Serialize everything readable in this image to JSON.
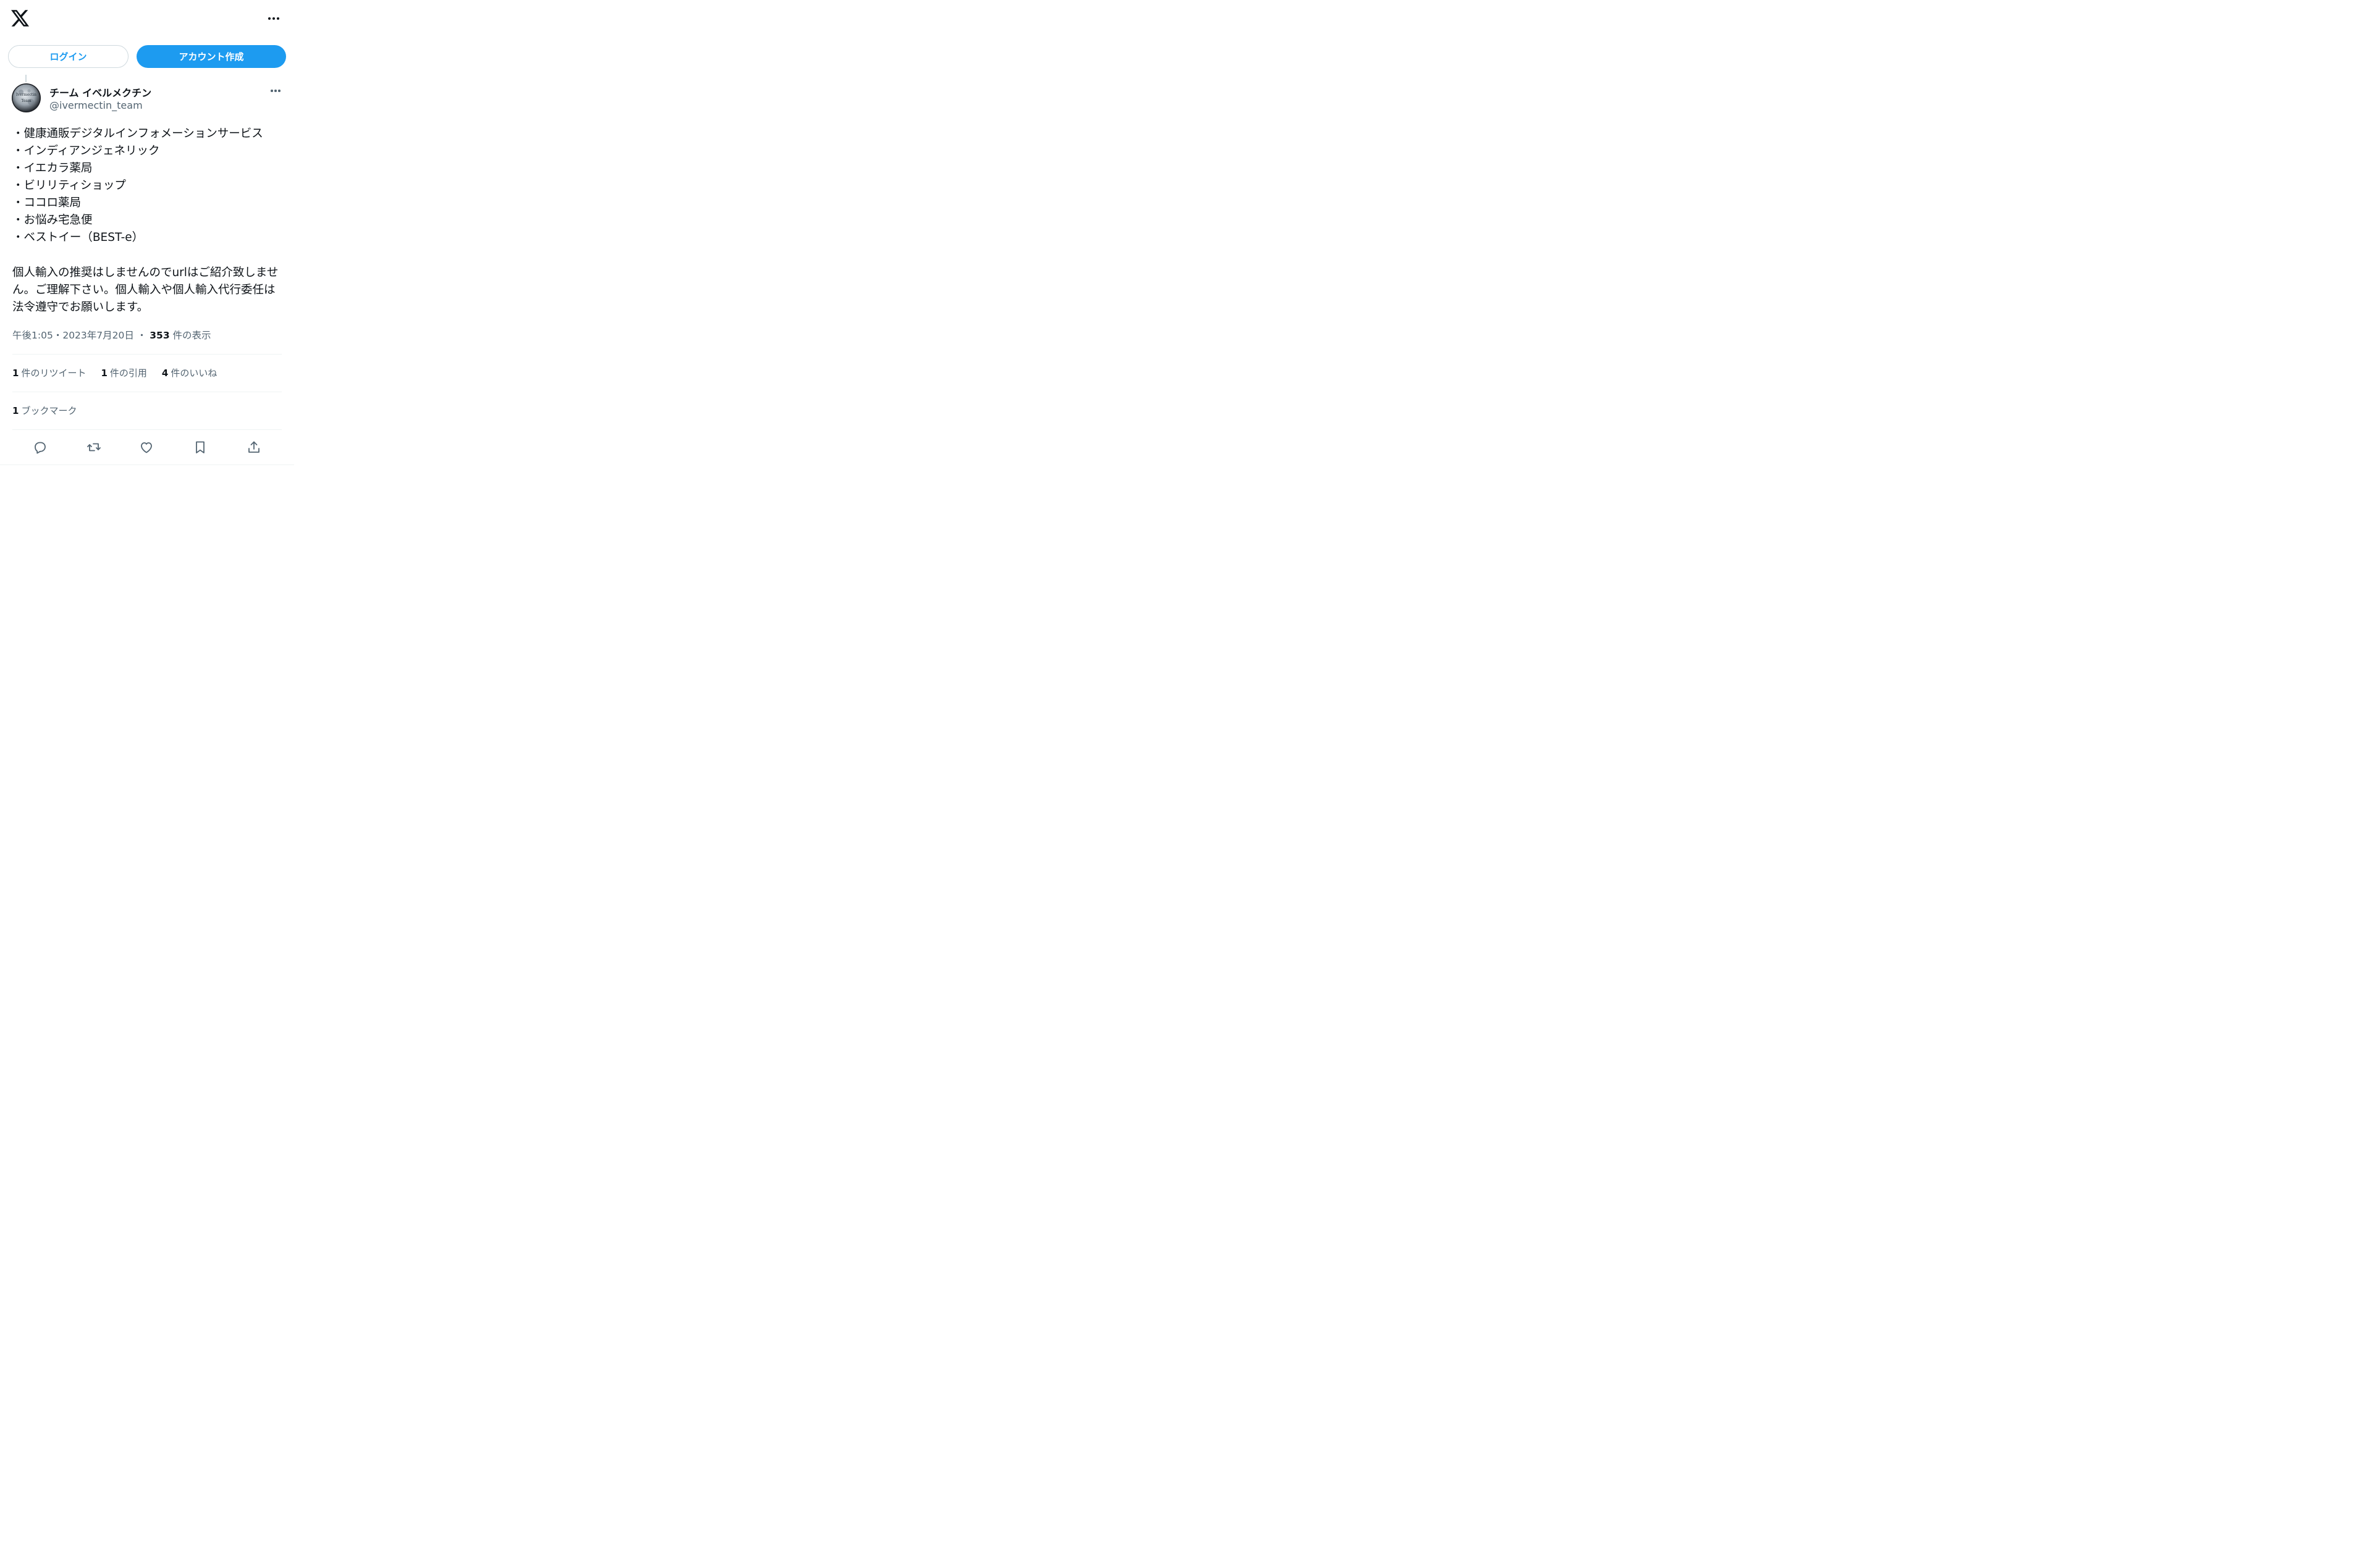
{
  "header": {
    "logo": "x-logo-icon",
    "more": "more-horizontal-icon"
  },
  "auth": {
    "login_label": "ログイン",
    "signup_label": "アカウント作成",
    "accent_color": "#1d9bf0"
  },
  "post": {
    "author_name": "チーム イベルメクチン",
    "handle": "@ivermectin_team",
    "avatar_text": [
      "Ivermectin",
      "Team"
    ],
    "lines": [
      "・健康通販デジタルインフォメーションサービス",
      "・インディアンジェネリック",
      "・イエカラ薬局",
      "・ビリリティショップ",
      "・ココロ薬局",
      "・お悩み宅急便",
      "・ベストイー（BEST-e）"
    ],
    "paragraph": "個人輸入の推奨はしませんのでurlはご紹介致しません。ご理解下さい。個人輸入や個人輸入代行委任は法令遵守でお願いします。",
    "time": "午後1:05",
    "date": "2023年7月20日",
    "separator": "・",
    "views_count": "353",
    "views_label": "件の表示"
  },
  "stats": {
    "retweets_count": "1",
    "retweets_label": "件のリツイート",
    "quotes_count": "1",
    "quotes_label": "件の引用",
    "likes_count": "4",
    "likes_label": "件のいいね",
    "bookmarks_count": "1",
    "bookmarks_label": "ブックマーク"
  },
  "actions": [
    "reply-icon",
    "retweet-icon",
    "like-icon",
    "bookmark-icon",
    "share-icon"
  ]
}
